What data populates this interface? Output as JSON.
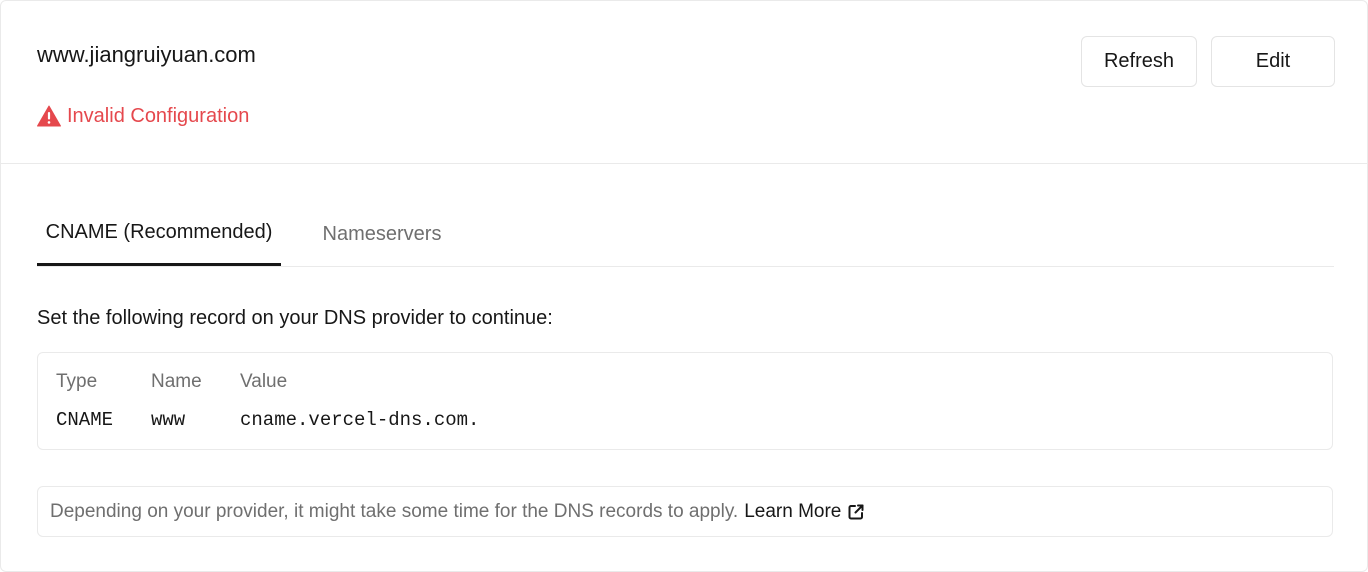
{
  "header": {
    "domain": "www.jiangruiyuan.com",
    "status_text": "Invalid Configuration",
    "status_icon": "warning-triangle-icon",
    "status_color": "#e5484d",
    "refresh_label": "Refresh",
    "edit_label": "Edit"
  },
  "tabs": [
    {
      "label": "CNAME (Recommended)",
      "active": true
    },
    {
      "label": "Nameservers",
      "active": false
    }
  ],
  "instruction": "Set the following record on your DNS provider to continue:",
  "record": {
    "columns": [
      "Type",
      "Name",
      "Value"
    ],
    "values": [
      "CNAME",
      "www",
      "cname.vercel-dns.com."
    ]
  },
  "note": {
    "text": "Depending on your provider, it might take some time for the DNS records to apply.",
    "link_label": "Learn More",
    "link_icon": "external-link-icon"
  }
}
